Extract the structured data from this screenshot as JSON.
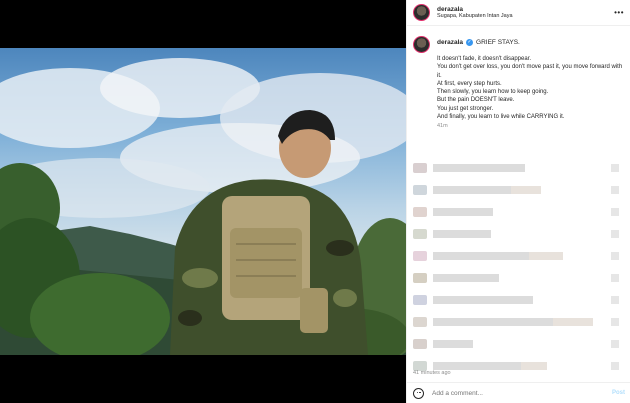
{
  "post": {
    "username": "derazala",
    "location": "Sugapa, Kabupaten Intan Jaya",
    "more_label": "•••"
  },
  "caption": {
    "username": "derazala",
    "verified_mark": "✓",
    "title": "GRIEF STAYS.",
    "lines": [
      "It doesn't fade, it doesn't disappear.",
      "You don't get over loss, you don't move past it, you move forward with it.",
      "At first, every step hurts.",
      "Then slowly, you learn how to keep going.",
      "But the pain DOESN'T leave.",
      "You just get stronger.",
      "And finally, you learn to live while CARRYING it."
    ],
    "time": "41m"
  },
  "comments": [
    {
      "w1": 92,
      "w2": 0
    },
    {
      "w1": 78,
      "w2": 30
    },
    {
      "w1": 60,
      "w2": 0
    },
    {
      "w1": 58,
      "w2": 0
    },
    {
      "w1": 96,
      "w2": 34
    },
    {
      "w1": 66,
      "w2": 0
    },
    {
      "w1": 100,
      "w2": 0
    },
    {
      "w1": 120,
      "w2": 40
    },
    {
      "w1": 40,
      "w2": 0
    },
    {
      "w1": 88,
      "w2": 26
    }
  ],
  "footer": {
    "time": "41 minutes ago",
    "add_comment_placeholder": "Add a comment...",
    "post_label": "Post"
  },
  "colors": {
    "accent": "#3897f0",
    "story_ring": "#e1306c"
  }
}
